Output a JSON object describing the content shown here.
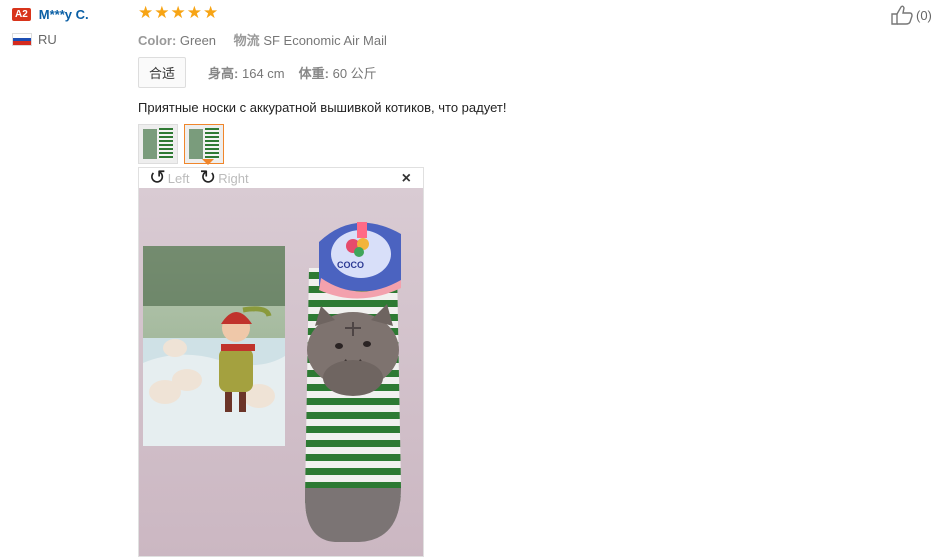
{
  "user": {
    "level_badge": "A2",
    "name": "M***y C.",
    "country": "RU"
  },
  "review": {
    "rating": 5,
    "color_label": "Color:",
    "color_value": "Green",
    "shipping_label": "物流",
    "shipping_value": "SF Economic Air Mail",
    "fit_tag": "合适",
    "height_label": "身高:",
    "height_value": "164 cm",
    "weight_label": "体重:",
    "weight_value": "60 公斤",
    "text": "Приятные носки с аккуратной вышивкой котиков, что радует!",
    "likes": "(0)"
  },
  "viewer": {
    "left_label": "Left",
    "right_label": "Right",
    "close_icon": "×",
    "rotate_left_icon": "↺",
    "rotate_right_icon": "↻",
    "brand_text": "COCO"
  },
  "colors": {
    "star": "#f7a414",
    "name": "#0a5fa5",
    "badge": "#d8341b",
    "active_thumb": "#f0862b"
  }
}
